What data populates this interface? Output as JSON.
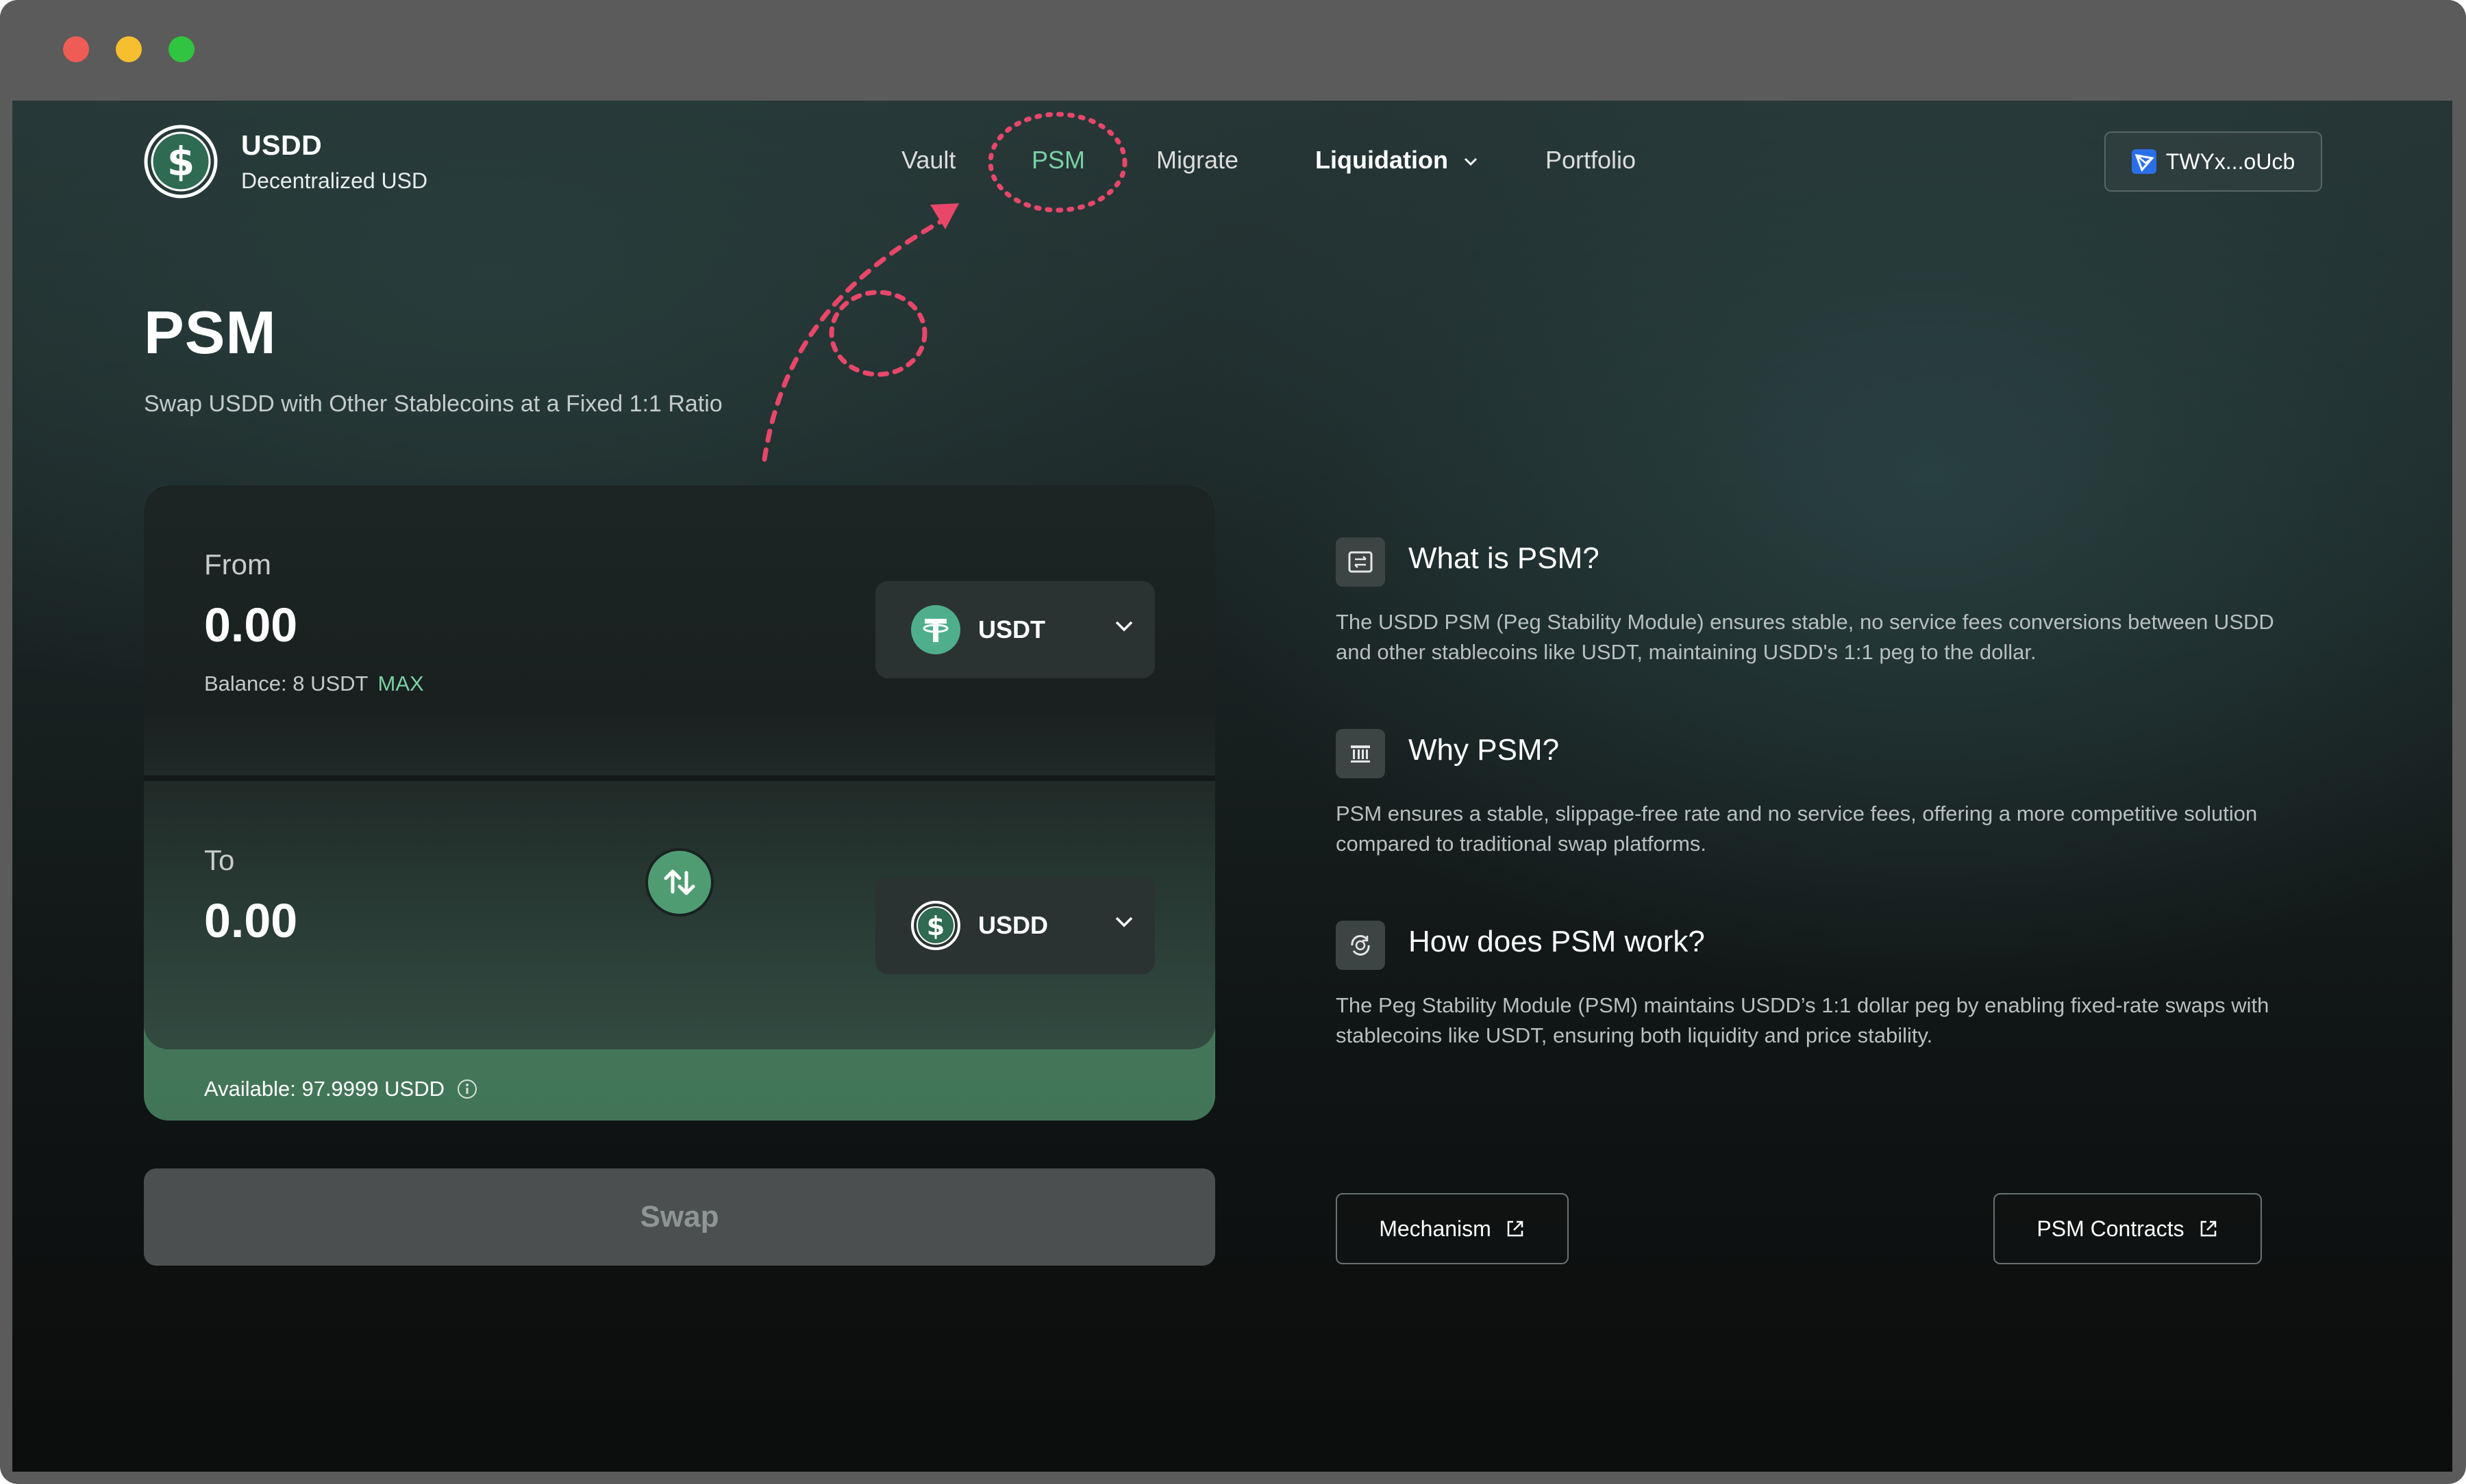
{
  "brand": {
    "name": "USDD",
    "subtitle": "Decentralized USD"
  },
  "nav": {
    "items": [
      {
        "label": "Vault"
      },
      {
        "label": "PSM"
      },
      {
        "label": "Migrate"
      },
      {
        "label": "Liquidation"
      },
      {
        "label": "Portfolio"
      }
    ],
    "active": "PSM"
  },
  "wallet": {
    "address": "TWYx...oUcb",
    "icon": "tronlink-wallet-icon"
  },
  "page": {
    "title": "PSM",
    "subtitle": "Swap USDD with Other Stablecoins at a Fixed 1:1 Ratio"
  },
  "swap": {
    "from": {
      "label": "From",
      "amount": "0.00",
      "balance_label": "Balance: 8 USDT",
      "max_label": "MAX",
      "token": "USDT"
    },
    "to": {
      "label": "To",
      "amount": "0.00",
      "token": "USDD"
    },
    "available_label": "Available: 97.9999 USDD",
    "button_label": "Swap"
  },
  "info": [
    {
      "icon": "swap-card-icon",
      "title": "What is PSM?",
      "body": "The USDD PSM (Peg Stability Module) ensures stable, no service fees conversions between USDD and other stablecoins like USDT, maintaining USDD's 1:1 peg to the dollar."
    },
    {
      "icon": "bank-icon",
      "title": "Why PSM?",
      "body": "PSM ensures a stable, slippage-free rate and no service fees, offering a more competitive solution compared to traditional swap platforms."
    },
    {
      "icon": "dollar-cycle-icon",
      "title": "How does PSM work?",
      "body": "The Peg Stability Module (PSM) maintains USDD’s 1:1 dollar peg by enabling fixed-rate swaps with stablecoins like USDT, ensuring both liquidity and price stability."
    }
  ],
  "links": {
    "mechanism": "Mechanism",
    "contracts": "PSM Contracts"
  },
  "colors": {
    "accent": "#7ad0a4",
    "annotation": "#e8476a",
    "usdt": "#4faf8c"
  }
}
